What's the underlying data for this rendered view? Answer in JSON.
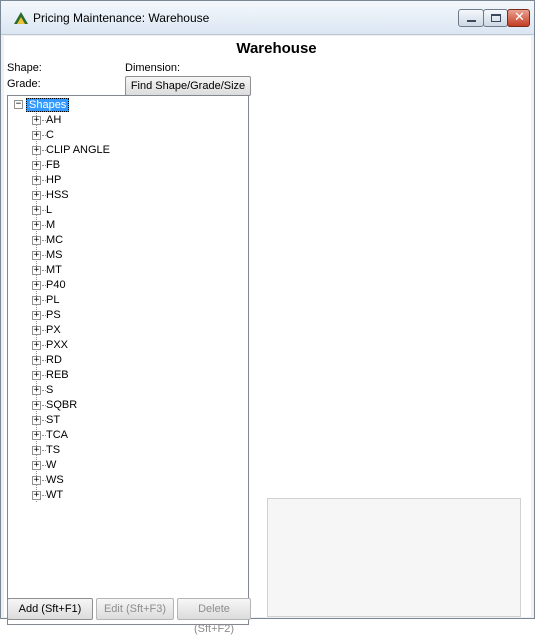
{
  "window": {
    "title": "Pricing Maintenance: Warehouse",
    "controls": {
      "minimize": "minimize-icon",
      "maximize": "maximize-icon",
      "close": "close-icon"
    }
  },
  "page": {
    "heading": "Warehouse",
    "shape_label": "Shape:",
    "dimension_label": "Dimension:",
    "grade_label": "Grade:",
    "find_button": "Find Shape/Grade/Size"
  },
  "tree": {
    "root": "Shapes",
    "nodes": [
      "AH",
      "C",
      "CLIP ANGLE",
      "FB",
      "HP",
      "HSS",
      "L",
      "M",
      "MC",
      "MS",
      "MT",
      "P40",
      "PL",
      "PS",
      "PX",
      "PXX",
      "RD",
      "REB",
      "S",
      "SQBR",
      "ST",
      "TCA",
      "TS",
      "W",
      "WS",
      "WT"
    ]
  },
  "buttons": {
    "add": "Add (Sft+F1)",
    "edit": "Edit (Sft+F3)",
    "delete": "Delete (Sft+F2)"
  },
  "colors": {
    "selection": "#3399ff",
    "close_button": "#c33d23"
  }
}
